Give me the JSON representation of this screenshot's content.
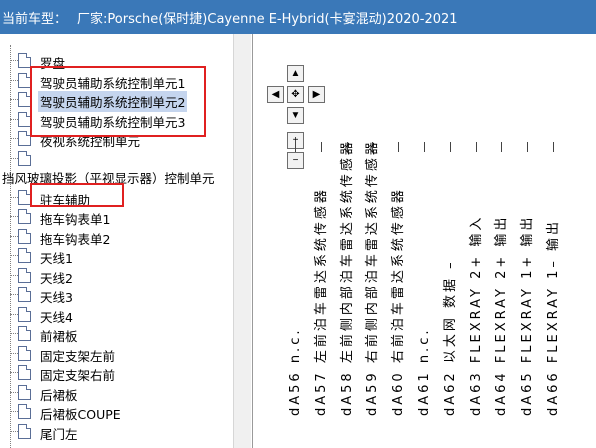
{
  "title_bar": {
    "label": "当前车型：",
    "vehicle": "厂家:Porsche(保时捷)Cayenne E-Hybrid(卡宴混动)2020-2021"
  },
  "tree": {
    "items": [
      {
        "label": "罗盘",
        "selected": false
      },
      {
        "label": "驾驶员辅助系统控制单元1",
        "selected": false
      },
      {
        "label": "驾驶员辅助系统控制单元2",
        "selected": true
      },
      {
        "label": "驾驶员辅助系统控制单元3",
        "selected": false
      },
      {
        "label": "夜视系统控制单元",
        "selected": false
      },
      {
        "label": "",
        "selected": false
      }
    ],
    "section_header": "挡风玻璃投影（平视显示器）控制单元",
    "section_items": [
      {
        "label": "驻车辅助",
        "selected": false
      },
      {
        "label": "拖车钩表单1",
        "selected": false
      },
      {
        "label": "拖车钩表单2",
        "selected": false
      },
      {
        "label": "天线1",
        "selected": false
      },
      {
        "label": "天线2",
        "selected": false
      },
      {
        "label": "天线3",
        "selected": false
      },
      {
        "label": "天线4",
        "selected": false
      },
      {
        "label": "前裙板",
        "selected": false
      },
      {
        "label": "固定支架左前",
        "selected": false
      },
      {
        "label": "固定支架右前",
        "selected": false
      },
      {
        "label": "后裙板",
        "selected": false
      },
      {
        "label": "后裙板COUPE",
        "selected": false
      },
      {
        "label": "尾门左",
        "selected": false
      }
    ]
  },
  "viewer": {
    "nav": {
      "up": "▲",
      "left": "◀",
      "center": "✥",
      "right": "▶",
      "down": "▼",
      "zoom_in": "+",
      "zoom_out": "−"
    },
    "pins": [
      "dA56 n.c.",
      "dA57 左前泊车雷达系统传感器",
      "dA58 左前侧内部泊车雷达系统传感器",
      "dA59 右前侧内部泊车雷达系统传感器",
      "dA60 右前泊车雷达系统传感器",
      "dA61 n.c.",
      "dA62 以太网 数据 –",
      "dA63 FLEXRAY 2+ 输入",
      "dA64 FLEXRAY 2+ 输出",
      "dA65 FLEXRAY 1+ 输出",
      "dA66 FLEXRAY 1– 输出"
    ]
  }
}
